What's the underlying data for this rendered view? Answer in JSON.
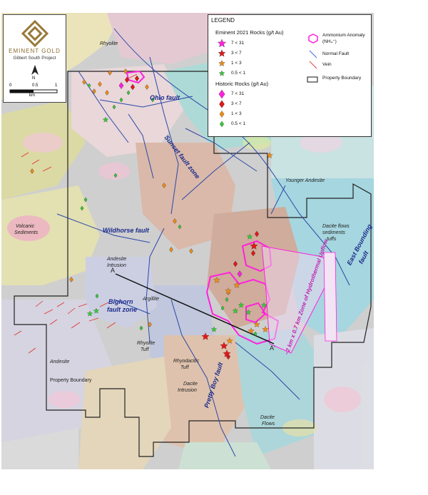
{
  "logo": {
    "company": "EMINENT GOLD",
    "project": "Gilbert South Project"
  },
  "scale": {
    "start": "0",
    "mid": "0.5",
    "end": "1",
    "unit": "km",
    "north": "N"
  },
  "legend": {
    "title": "LEGEND",
    "eminent_header": "Eminent 2021 Rocks (g/t Au)",
    "eminent_items": [
      "7 < 31",
      "3 < 7",
      "1 < 3",
      "0.5 < 1"
    ],
    "historic_header": "Historic Rocks (g/t Au)",
    "historic_items": [
      "7 < 31",
      "3 < 7",
      "1 < 3",
      "0.5 < 1"
    ],
    "ammonium_label": "Ammonium Anomaly (NH₄⁺)",
    "normal_fault_label": "Normal Fault",
    "vein_label": "Vein",
    "property_label": "Property Boundary",
    "colors": {
      "magenta": "#ff22dd",
      "red": "#e01818",
      "orange": "#f08c10",
      "green": "#33cc33",
      "fault": "#3a6ed8",
      "vein": "#e04040"
    }
  },
  "faults": {
    "ohio": "Ohio fault",
    "sunset": "Sunset fault zone",
    "wildhorse": "Wildhorse fault",
    "bighorn_1": "Bighorn",
    "bighorn_2": "fault zone",
    "pretty_boy": "Pretty Boy fault",
    "east_bounding_1": "East Bounding",
    "east_bounding_2": "fault"
  },
  "units": {
    "rhyolite_top": "Rhyolite",
    "younger_andesite": "Younger Andesite",
    "volcanic_1": "Volcanic",
    "volcanic_2": "Sediments",
    "andesite_intrusion_1": "Andesite",
    "andesite_intrusion_2": "Intrusion",
    "argillite": "Argillite",
    "dacite_flows_1": "Dacite flows",
    "dacite_flows_2": "sediments",
    "dacite_flows_3": "tuffs",
    "andesite": "Andesite",
    "property_boundary": "Property Boundary",
    "rhyolite_tuff_1": "Rhyolite",
    "rhyolite_tuff_2": "Tuff",
    "rhyodacitic_1": "Rhyodacitic",
    "rhyodacitic_2": "Tuff",
    "dacite_intrusion_1": "Dacite",
    "dacite_intrusion_2": "Intrusion",
    "dacite_flows_b1": "Dacite",
    "dacite_flows_b2": "Flows"
  },
  "section": {
    "start": "A",
    "end": "A'"
  },
  "annotation": "~2 km x 0.7 km Zone of Hydrothermal Upflow"
}
